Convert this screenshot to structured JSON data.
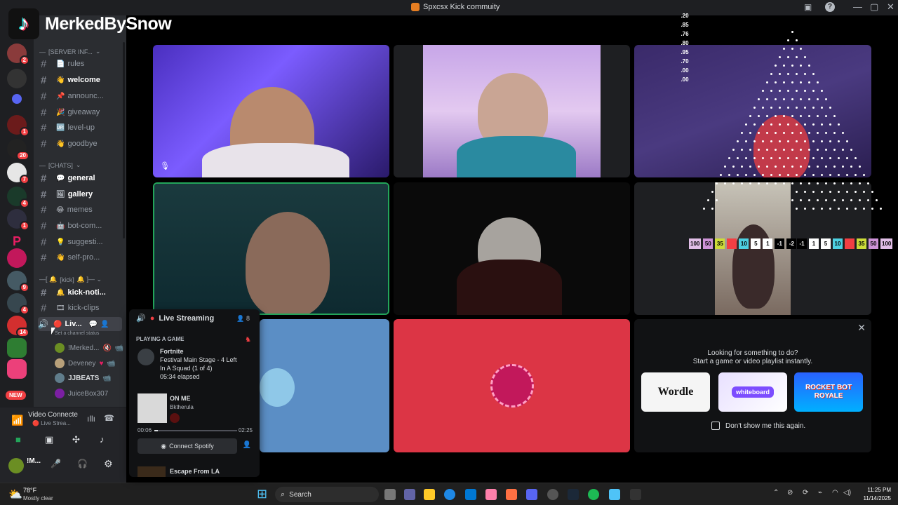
{
  "overlay": {
    "tiktok_name": "MerkedBySnow"
  },
  "window": {
    "title": "Spxcsx Kick commuity"
  },
  "channels": {
    "cat_server": "[SERVER INF...",
    "cat_chats": "[CHATS]",
    "cat_kick": "[kick]",
    "items": [
      {
        "label": "rules",
        "emoji": "📄",
        "unread": false
      },
      {
        "label": "welcome",
        "emoji": "👋",
        "unread": true
      },
      {
        "label": "announc...",
        "emoji": "📌",
        "unread": false
      },
      {
        "label": "giveaway",
        "emoji": "🎉",
        "unread": false
      },
      {
        "label": "level-up",
        "emoji": "🆙",
        "unread": false
      },
      {
        "label": "goodbye",
        "emoji": "👋",
        "unread": false
      },
      {
        "label": "general",
        "emoji": "💬",
        "unread": true
      },
      {
        "label": "gallery",
        "emoji": "🖼",
        "unread": true
      },
      {
        "label": "memes",
        "emoji": "😂",
        "unread": false
      },
      {
        "label": "bot-com...",
        "emoji": "🤖",
        "unread": false
      },
      {
        "label": "suggesti...",
        "emoji": "💡",
        "unread": false
      },
      {
        "label": "self-pro...",
        "emoji": "👋",
        "unread": false
      },
      {
        "label": "kick-noti...",
        "emoji": "🔔",
        "unread": true
      },
      {
        "label": "kick-clips",
        "emoji": "🎞",
        "unread": false
      }
    ],
    "voice_channel": "Liv...",
    "voice_status_hint": "Set a channel status",
    "voice_users": [
      "!Merked...",
      "Deveney",
      "JJBEATS",
      "JuiceBox307"
    ]
  },
  "server_badges": [
    "2",
    "1",
    "20",
    "7",
    "4",
    "1",
    "9",
    "4",
    "14"
  ],
  "new_label": "NEW",
  "voice_panel": {
    "status": "Video Connecte",
    "channel": "Live Strea..."
  },
  "user_panel": {
    "name": "!M..."
  },
  "popup": {
    "channel": "Live Streaming",
    "count": "8",
    "section": "PLAYING A GAME",
    "game": {
      "name": "Fortnite",
      "detail1": "Festival Main Stage - 4 Left",
      "detail2": "In A Squad (1 of 4)",
      "elapsed": "05:34 elapsed"
    },
    "music": {
      "title": "ON ME",
      "artist": "Bktherula",
      "current": "00:06",
      "total": "02:25",
      "progress": 0.04
    },
    "spotify_button": "Connect Spotify",
    "next_item": "Escape From LA"
  },
  "activity": {
    "line1": "Looking for something to do?",
    "line2": "Start a game or video playlist instantly.",
    "cards": [
      "Wordle",
      "whiteboard",
      "ROCKET BOT ROYALE"
    ],
    "dont_show": "Don't show me this again."
  },
  "overlay_numbers": [
    ".20",
    ".85",
    ".76",
    ".80",
    ".95",
    ".70",
    ".00",
    ".00"
  ],
  "score_row_left": [
    "100",
    "50",
    "35",
    "10",
    "5",
    "1",
    "-1",
    "-2"
  ],
  "score_row_right": [
    "-1",
    "1",
    "5",
    "10",
    "35",
    "50",
    "100"
  ],
  "taskbar": {
    "weather_temp": "78°F",
    "weather_desc": "Mostly clear",
    "search": "Search",
    "time": "11:25 PM",
    "date": "11/14/2025"
  },
  "colors": {
    "accent": "#5865f2",
    "danger": "#f23f43",
    "success": "#23a55a",
    "stage_red": "#dc3545",
    "stage_blue": "#5b8ec5"
  }
}
